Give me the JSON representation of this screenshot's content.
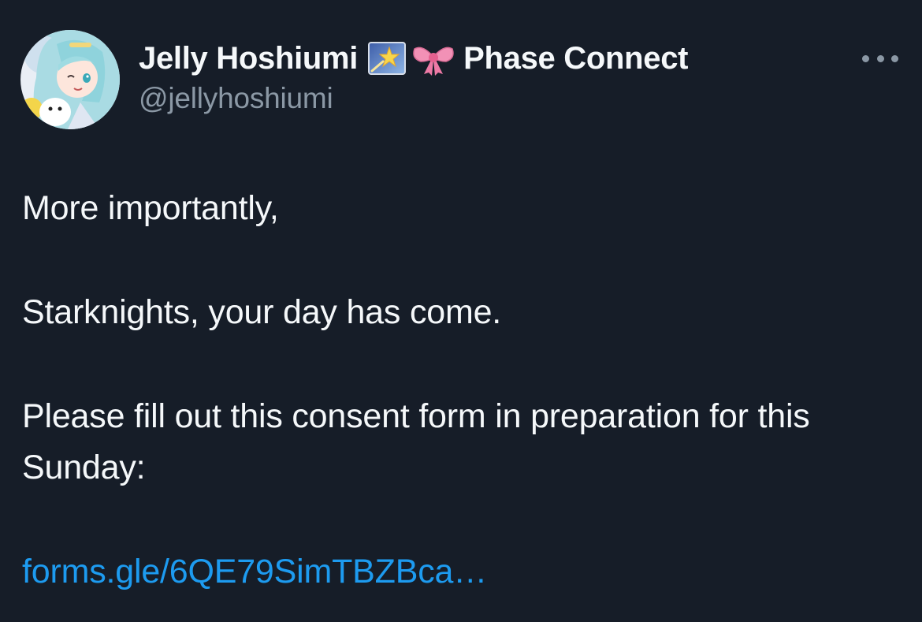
{
  "tweet": {
    "author": {
      "display_name": "Jelly Hoshiumi",
      "emoji_1": "star-badge-icon",
      "emoji_2": "ribbon-bow-icon",
      "affiliation": "Phase Connect",
      "handle": "@jellyhoshiumi"
    },
    "body": {
      "line1": "More importantly,",
      "line2": "Starknights, your day has come.",
      "line3": "Please fill out this consent form in preparation for this Sunday:",
      "link": "forms.gle/6QE79SimTBZBca…"
    }
  },
  "colors": {
    "background": "#161d28",
    "text": "#f5f8fa",
    "secondary": "#8b98a5",
    "link": "#1d9bf0"
  }
}
